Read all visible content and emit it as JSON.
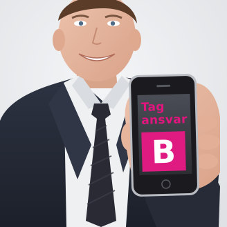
{
  "phone_screen": {
    "line1": "Tag",
    "line2": "ansvar",
    "logo_letter": "B",
    "accent_color": "#df1b82"
  },
  "colors": {
    "background": "#e9eaec",
    "suit": "#252a36",
    "shirt": "#eef0f2",
    "tie": "#2a2a34",
    "skin": "#e7b89f",
    "hair": "#5a3c28",
    "phone_body": "#1b1b1f",
    "phone_bezel": "#b9bcc2"
  }
}
